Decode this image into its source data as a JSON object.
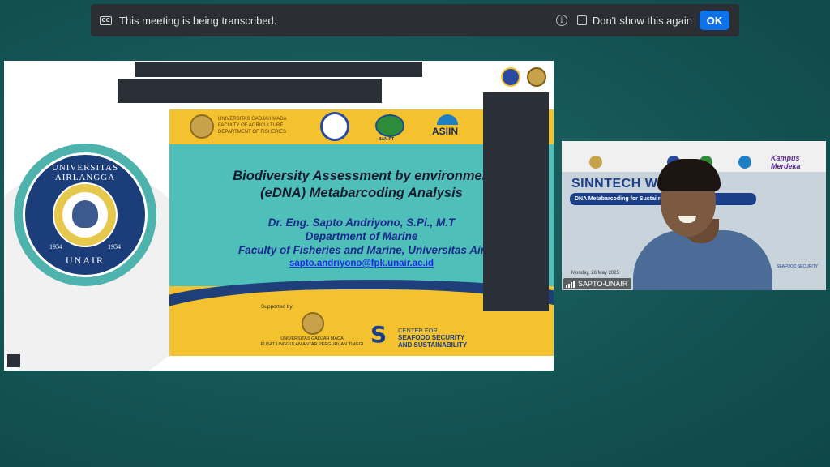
{
  "banner": {
    "cc_icon_text": "CC",
    "message": "This meeting is being transcribed.",
    "info_icon_glyph": "i",
    "checkbox_label": "Don't show this again",
    "ok_label": "OK"
  },
  "shared_screen": {
    "university_seal": {
      "top_text": "UNIVERSITAS AIRLANGGA",
      "bottom_text": "UNAIR",
      "year_left": "1954",
      "year_right": "1954"
    },
    "slide": {
      "header_ugm_text": [
        "UNIVERSITAS GADJAH MADA",
        "FACULTY OF AGRICULTURE",
        "DEPARTMENT OF FISHERIES"
      ],
      "banpt_label": "BAN-PT",
      "asiin_label": "ASIIN",
      "title_line1": "Biodiversity Assessment by environmen",
      "title_line2": "(eDNA) Metabarcoding Analysis",
      "author": "Dr. Eng. Sapto Andriyono, S.Pi., M.T",
      "department": "Department of Marine",
      "faculty": "Faculty of Fisheries and Marine, Universitas Air",
      "email": "sapto.andriyono@fpk.unair.ac.id",
      "supported_by": "Supported by:",
      "ugm_small_line1": "UNIVERSITAS GADJAH MADA",
      "ugm_small_line2": "PUSAT UNGGULAN ANTAR PERGURUAN TINGGI",
      "s_logo_glyph": "S",
      "center_line1": "CENTER FOR",
      "center_line2": "SEAFOOD SECURITY",
      "center_line3": "AND SUSTAINABILITY"
    }
  },
  "participant_video": {
    "title": "SINNTECH WE      25",
    "strip_text": "DNA Metabarcoding for Sustai                    rce",
    "kampus_line1": "Kampus",
    "kampus_line2": "Merdeka",
    "asiin_label": "ASIIN",
    "date_text": "Monday, 26 May 2025",
    "right_logo_text": "SEAFOOD SECURITY",
    "name": "SAPTO-UNAIR"
  },
  "colors": {
    "banner_bg": "#2b2f33",
    "ok_button": "#0e72ed",
    "slide_yellow": "#f3c22e",
    "slide_teal": "#4fbfba",
    "unair_blue": "#1b3d7a",
    "redaction": "#2b3038"
  }
}
